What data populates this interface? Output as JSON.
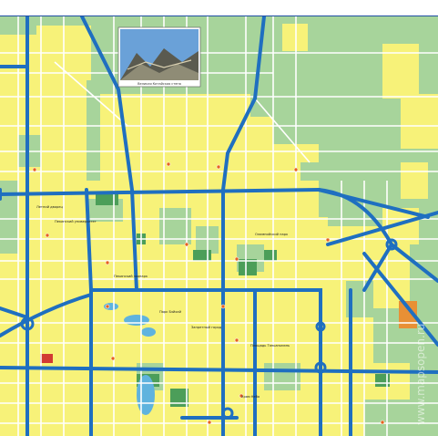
{
  "map": {
    "colors": {
      "urban": "#f7f279",
      "green": "#a7d49b",
      "park": "#4c9e59",
      "major_road": "#1f6fc0",
      "minor_road": "#ffffff",
      "water": "#5fb3de",
      "orange_block": "#e89035",
      "red_block": "#d23a33",
      "border": "#1f4fa3"
    },
    "photo": {
      "caption": "Великая Китайская стена"
    },
    "labels": [
      "Пекинский университет",
      "Парк Бэйхай",
      "Храм Неба",
      "Запретный город",
      "Пекинский зоопарк",
      "Площадь Тяньаньмэнь",
      "Олимпийский парк",
      "Летний дворец"
    ],
    "watermark": "www.mapsopen.ru",
    "icons": [
      "poi-marker-icon"
    ]
  }
}
